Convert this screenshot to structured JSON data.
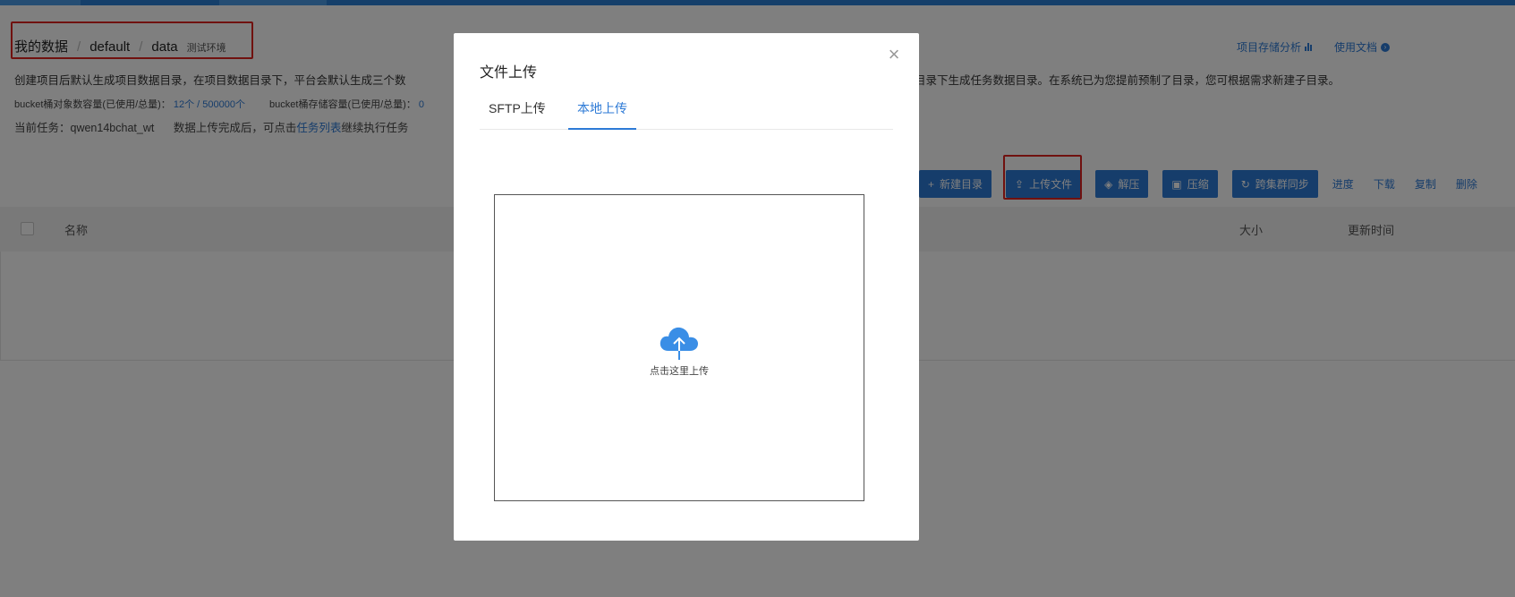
{
  "breadcrumb": {
    "items": [
      "我的数据",
      "default",
      "data"
    ],
    "env_tag": "测试环境"
  },
  "top_links": {
    "storage_analysis": "项目存储分析",
    "docs": "使用文档"
  },
  "description": "创建项目后默认生成项目数据目录，在项目数据目录下，平台会默认生成三个数",
  "description_right": "数据目录下生成任务数据目录。在系统已为您提前预制了目录，您可根据需求新建子目录。",
  "quota": {
    "object_label": "bucket桶对象数容量(已使用/总量)：",
    "object_value": "12个 / 500000个",
    "storage_label": "bucket桶存储容量(已使用/总量)：",
    "storage_value": "0"
  },
  "task": {
    "label": "当前任务：qwen14bchat_wt",
    "hint_prefix": "数据上传完成后，可点击",
    "hint_link": "任务列表",
    "hint_suffix": "继续执行任务"
  },
  "toolbar": {
    "new_dir": "新建目录",
    "upload_file": "上传文件",
    "unzip": "解压",
    "zip": "压缩",
    "cross_sync": "跨集群同步",
    "links": [
      "进度",
      "下载",
      "复制",
      "删除"
    ]
  },
  "table": {
    "columns": {
      "name": "名称",
      "size": "大小",
      "updated": "更新时间"
    }
  },
  "modal": {
    "title": "文件上传",
    "tabs": [
      {
        "label": "SFTP上传",
        "active": false
      },
      {
        "label": "本地上传",
        "active": true
      }
    ],
    "upload_hint": "点击这里上传",
    "upload_icon": "cloud-upload-icon"
  },
  "colors": {
    "primary": "#2d7ad6",
    "highlight": "#e0221f",
    "overlay": "rgba(0,0,0,0.5)"
  }
}
